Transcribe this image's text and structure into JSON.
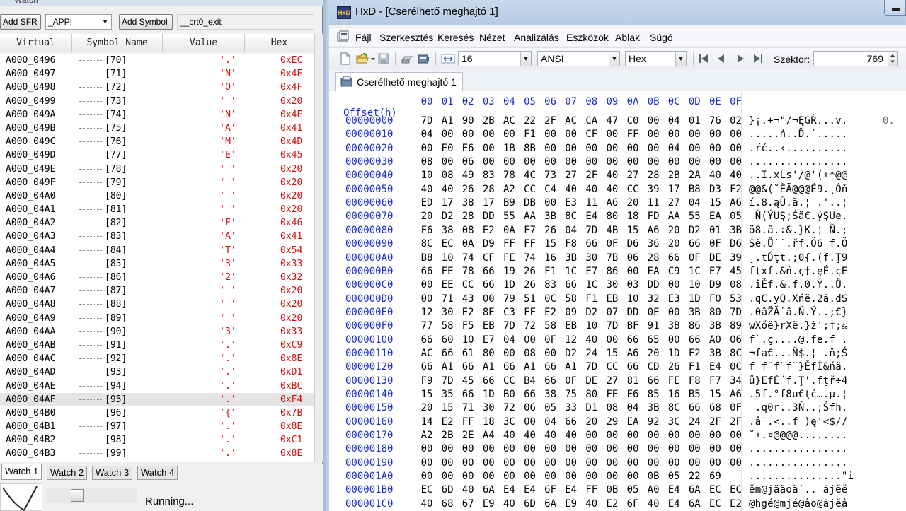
{
  "watch": {
    "title": "Watch",
    "toolbar": {
      "add_sfr_label": "Add SFR",
      "sfr_combo_value": "_APPI",
      "add_symbol_label": "Add Symbol",
      "symbol_combo_value": "__crt0_exit"
    },
    "columns": [
      "Virtual",
      "Symbol Name",
      "Value",
      "Hex"
    ],
    "rows": [
      {
        "virtual": "A000_0496",
        "symbol": "[70]",
        "value": "'.'",
        "hex": "0xEC"
      },
      {
        "virtual": "A000_0497",
        "symbol": "[71]",
        "value": "'N'",
        "hex": "0x4E"
      },
      {
        "virtual": "A000_0498",
        "symbol": "[72]",
        "value": "'O'",
        "hex": "0x4F"
      },
      {
        "virtual": "A000_0499",
        "symbol": "[73]",
        "value": "' '",
        "hex": "0x20"
      },
      {
        "virtual": "A000_049A",
        "symbol": "[74]",
        "value": "'N'",
        "hex": "0x4E"
      },
      {
        "virtual": "A000_049B",
        "symbol": "[75]",
        "value": "'A'",
        "hex": "0x41"
      },
      {
        "virtual": "A000_049C",
        "symbol": "[76]",
        "value": "'M'",
        "hex": "0x4D"
      },
      {
        "virtual": "A000_049D",
        "symbol": "[77]",
        "value": "'E'",
        "hex": "0x45"
      },
      {
        "virtual": "A000_049E",
        "symbol": "[78]",
        "value": "' '",
        "hex": "0x20"
      },
      {
        "virtual": "A000_049F",
        "symbol": "[79]",
        "value": "' '",
        "hex": "0x20"
      },
      {
        "virtual": "A000_04A0",
        "symbol": "[80]",
        "value": "' '",
        "hex": "0x20"
      },
      {
        "virtual": "A000_04A1",
        "symbol": "[81]",
        "value": "' '",
        "hex": "0x20"
      },
      {
        "virtual": "A000_04A2",
        "symbol": "[82]",
        "value": "'F'",
        "hex": "0x46"
      },
      {
        "virtual": "A000_04A3",
        "symbol": "[83]",
        "value": "'A'",
        "hex": "0x41"
      },
      {
        "virtual": "A000_04A4",
        "symbol": "[84]",
        "value": "'T'",
        "hex": "0x54"
      },
      {
        "virtual": "A000_04A5",
        "symbol": "[85]",
        "value": "'3'",
        "hex": "0x33"
      },
      {
        "virtual": "A000_04A6",
        "symbol": "[86]",
        "value": "'2'",
        "hex": "0x32"
      },
      {
        "virtual": "A000_04A7",
        "symbol": "[87]",
        "value": "' '",
        "hex": "0x20"
      },
      {
        "virtual": "A000_04A8",
        "symbol": "[88]",
        "value": "' '",
        "hex": "0x20"
      },
      {
        "virtual": "A000_04A9",
        "symbol": "[89]",
        "value": "' '",
        "hex": "0x20"
      },
      {
        "virtual": "A000_04AA",
        "symbol": "[90]",
        "value": "'3'",
        "hex": "0x33"
      },
      {
        "virtual": "A000_04AB",
        "symbol": "[91]",
        "value": "'.'",
        "hex": "0xC9"
      },
      {
        "virtual": "A000_04AC",
        "symbol": "[92]",
        "value": "'.'",
        "hex": "0x8E"
      },
      {
        "virtual": "A000_04AD",
        "symbol": "[93]",
        "value": "'.'",
        "hex": "0xD1"
      },
      {
        "virtual": "A000_04AE",
        "symbol": "[94]",
        "value": "'.'",
        "hex": "0xBC"
      },
      {
        "virtual": "A000_04AF",
        "symbol": "[95]",
        "value": "'.'",
        "hex": "0xF4"
      },
      {
        "virtual": "A000_04B0",
        "symbol": "[96]",
        "value": "'{'",
        "hex": "0x7B"
      },
      {
        "virtual": "A000_04B1",
        "symbol": "[97]",
        "value": "'.'",
        "hex": "0x8E"
      },
      {
        "virtual": "A000_04B2",
        "symbol": "[98]",
        "value": "'.'",
        "hex": "0xC1"
      },
      {
        "virtual": "A000_04B3",
        "symbol": "[99]",
        "value": "'.'",
        "hex": "0x8E"
      }
    ],
    "selected_row_index": 25,
    "tabs": [
      "Watch 1",
      "Watch 2",
      "Watch 3",
      "Watch 4"
    ],
    "active_tab_index": 0,
    "status_text": "Running..."
  },
  "hxd": {
    "window_title": "HxD - [Cserélhető meghajtó 1]",
    "logo_text": "HxD",
    "menu": [
      "Fájl",
      "Szerkesztés",
      "Keresés",
      "Nézet",
      "Analizálás",
      "Eszközök",
      "Ablak",
      "Súgó"
    ],
    "toolbar": {
      "bytes_per_row": "16",
      "charset": "ANSI",
      "offset_base": "Hex",
      "sector_label": "Szektor:",
      "sector_value": "769"
    },
    "document_tab": "Cserélhető meghajtó 1",
    "offset_header": "Offset(h)",
    "column_headers": [
      "00",
      "01",
      "02",
      "03",
      "04",
      "05",
      "06",
      "07",
      "08",
      "09",
      "0A",
      "0B",
      "0C",
      "0D",
      "0E",
      "0F"
    ],
    "side_text": "0.",
    "rows": [
      {
        "offset": "00000000",
        "bytes": "7D A1 90 2B AC 22 2F AC CA 47 C0 00 04 01 76 02",
        "text": "}¡.+¬\"/¬ĘGŔ...v."
      },
      {
        "offset": "00000010",
        "bytes": "04 00 00 00 00 F1 00 00 CF 00 FF 00 00 00 00 00",
        "text": ".....ń..Ď.˙....."
      },
      {
        "offset": "00000020",
        "bytes": "00 E0 E6 00 1B 8B 00 00 00 00 00 00 04 00 00 00",
        "text": ".ŕć..‹.........."
      },
      {
        "offset": "00000030",
        "bytes": "08 00 06 00 00 00 00 00 00 00 00 00 00 00 00 00",
        "text": "................"
      },
      {
        "offset": "00000040",
        "bytes": "10 08 49 83 78 4C 73 27 2F 40 27 28 2B 2A 40 40",
        "text": "..I.xLs'/@'(+*@@"
      },
      {
        "offset": "00000050",
        "bytes": "40 40 26 28 A2 CC C4 40 40 40 CC 39 17 B8 D3 F2",
        "text": "@@&(˘ĚÄ@@@Ě9.¸Óň"
      },
      {
        "offset": "00000060",
        "bytes": "ED 17 38 17 B9 DB 00 E3 11 A6 20 11 27 04 15 A6",
        "text": "í.8.ąŰ.ă.¦ .'..¦"
      },
      {
        "offset": "00000070",
        "bytes": "20 D2 28 DD 55 AA 3B 8C E4 80 18 FD AA 55 EA 05",
        "text": " Ň(ÝUŞ;Śä€.ýŞUę."
      },
      {
        "offset": "00000080",
        "bytes": "F6 38 08 E2 0A F7 26 04 7D 4B 15 A6 20 D2 01 3B",
        "text": "ö8.â.÷&.}K.¦ Ň.;"
      },
      {
        "offset": "00000090",
        "bytes": "8C EC 0A D9 FF FF 15 F8 66 0F D6 36 20 66 0F D6",
        "text": "Śě.Ů˙˙.řf.Ö6 f.Ö"
      },
      {
        "offset": "000000A0",
        "bytes": "B8 10 74 CF FE 74 16 3B 30 7B 06 28 66 0F DE 39",
        "text": "¸.tĎţt.;0{.(f.Ţ9"
      },
      {
        "offset": "000000B0",
        "bytes": "66 FE 78 66 19 26 F1 1C E7 86 00 EA C9 1C E7 45",
        "text": "fţxf.&ń.ç†.ęÉ.çE"
      },
      {
        "offset": "000000C0",
        "bytes": "00 EE CC 66 1D 26 83 66 1C 30 03 DD 00 10 D9 08",
        "text": ".îĚf.&.f.0.Ý..Ů."
      },
      {
        "offset": "000000D0",
        "bytes": "00 71 43 00 79 51 0C 58 F1 EB 10 32 E3 1D F0 53",
        "text": ".qC.yQ.Xńë.2ă.đS"
      },
      {
        "offset": "000000E0",
        "bytes": "12 30 E2 8E C3 FF E2 09 D2 07 DD 0E 00 3B 80 7D",
        "text": ".0âŽĂ˙â.Ň.Ý..;€}"
      },
      {
        "offset": "000000F0",
        "bytes": "77 58 F5 EB 7D 72 58 EB 10 7D BF 91 3B 86 3B 89",
        "text": "wXőë}rXë.}ż';†;‰"
      },
      {
        "offset": "00000100",
        "bytes": "66 60 10 E7 04 00 0F 12 40 00 66 65 00 66 A0 06",
        "text": "f`.ç....@.fe.f ."
      },
      {
        "offset": "00000110",
        "bytes": "AC 66 61 80 00 08 00 D2 24 15 A6 20 1D F2 3B 8C",
        "text": "¬fa€...Ň$.¦ .ň;Ś"
      },
      {
        "offset": "00000120",
        "bytes": "66 A1 66 A1 66 A1 66 A1 7D CC 66 CD 26 F1 E4 0C",
        "text": "f˘f˘f˘f˘}ĚfÍ&ńä."
      },
      {
        "offset": "00000130",
        "bytes": "F9 7D 45 66 CC B4 66 0F DE 27 81 66 FE F8 F7 34",
        "text": "ů}EfĚ´f.Ţ'.fţř÷4"
      },
      {
        "offset": "00000140",
        "bytes": "15 35 66 1D B0 66 38 75 80 FE E6 85 16 B5 15 A6",
        "text": ".5f.°f8u€ţć….µ.¦"
      },
      {
        "offset": "00000150",
        "bytes": "20 15 71 30 72 06 05 33 D1 08 04 3B 8C 66 68 0F",
        "text": " .q0r..3Ń..;Śfh."
      },
      {
        "offset": "00000160",
        "bytes": "14 E2 FF 18 3C 00 04 66 20 29 EA 92 3C 24 2F 2F",
        "text": ".â˙.<..f )ę'<$//"
      },
      {
        "offset": "00000170",
        "bytes": "A2 2B 2E A4 40 40 40 40 00 00 00 00 00 00 00 00",
        "text": "˘+.¤@@@@........"
      },
      {
        "offset": "00000180",
        "bytes": "00 00 00 00 00 00 00 00 00 00 00 00 00 00 00 00",
        "text": "................"
      },
      {
        "offset": "00000190",
        "bytes": "00 00 00 00 00 00 00 00 00 00 00 00 00 00 00 00",
        "text": "................"
      },
      {
        "offset": "000001A0",
        "bytes": "00 00 00 00 00 00 00 00 00 00 00 0B 05 22 69",
        "text": "...............\"i"
      },
      {
        "offset": "000001B0",
        "bytes": "EC 6D 40 6A E4 E4 6F E4 FF 0B 05 A0 E4 6A EC EC",
        "text": "ěm@jääoä˙.. äjěě"
      },
      {
        "offset": "000001C0",
        "bytes": "40 68 67 E9 40 6D 6A E9 40 E2 6F 40 E4 6A EC E2",
        "text": "@hgé@mjé@âo@äjěâ"
      }
    ]
  },
  "colors": {
    "offset_blue": "#1a2ec8",
    "watch_value_red": "#d01010",
    "hxd_frame": "#bcd0e6"
  }
}
